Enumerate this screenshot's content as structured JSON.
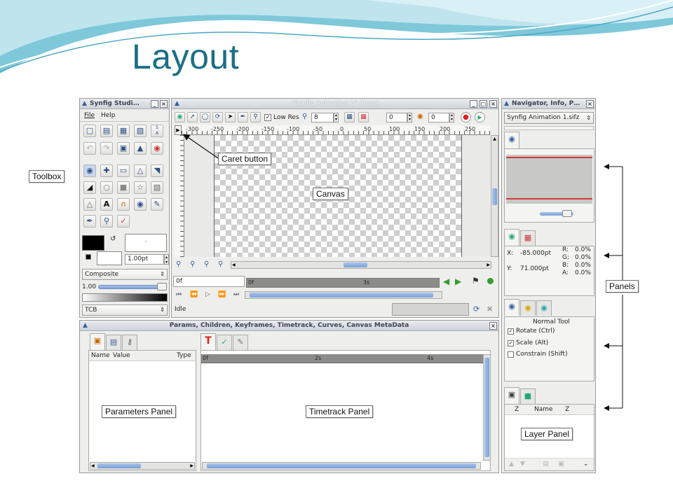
{
  "slide": {
    "title": "Layout"
  },
  "toolbox": {
    "title": "Synfig Studi…",
    "menu": [
      "File",
      "Help"
    ],
    "outline_width": "1.00pt",
    "blend_method": "Composite",
    "amount": "1.00",
    "gradient_label": "TCB"
  },
  "canvas_window": {
    "title": "\"Synfig Animation 1\" (Root)",
    "low_res_label": "Low Res",
    "zoom_value": "8",
    "field_a": "0",
    "field_b": "0",
    "ruler_ticks": [
      "-300",
      "-250",
      "-200",
      "-150",
      "-100",
      "-50",
      "0",
      "50",
      "100",
      "150",
      "200",
      "250"
    ],
    "current_frame": "0f",
    "timebar_start": "0f",
    "timebar_mark": "3s",
    "status": "Idle"
  },
  "navigator": {
    "title": "Navigator, Info, P…",
    "file_select": "Synfig Animation 1.sifz"
  },
  "info": {
    "x_label": "X:",
    "x_value": "-85.000pt",
    "y_label": "Y:",
    "y_value": "71.000pt",
    "r": "R:",
    "r_value": "0.0%",
    "g": "G:",
    "g_value": "0.0%",
    "b": "B:",
    "b_value": "0.0%",
    "a": "A:",
    "a_value": "0.0%"
  },
  "tool_options": {
    "heading": "Normal Tool",
    "options": [
      "Rotate (Ctrl)",
      "Scale (Alt)",
      "Constrain (Shift)"
    ],
    "checked": [
      true,
      true,
      false
    ]
  },
  "layers": {
    "col_z": "Z",
    "col_name": "Name",
    "col_z2": "Z"
  },
  "params_window": {
    "title": "Params, Children, Keyframes, Timetrack, Curves, Canvas MetaData",
    "col_name": "Name",
    "col_value": "Value",
    "col_type": "Type",
    "tt_start": "0f",
    "tt_mark1": "2s",
    "tt_mark2": "4s"
  },
  "annotations": {
    "toolbox": "Toolbox",
    "caret": "Caret button",
    "canvas": "Canvas",
    "panels": "Panels",
    "parameters": "Parameters Panel",
    "timetrack": "Timetrack Panel",
    "layer": "Layer Panel"
  },
  "colors": {
    "title": "#1b6f86",
    "accent_blue": "#7aa0d8",
    "navigator_line": "#d43a3a"
  }
}
